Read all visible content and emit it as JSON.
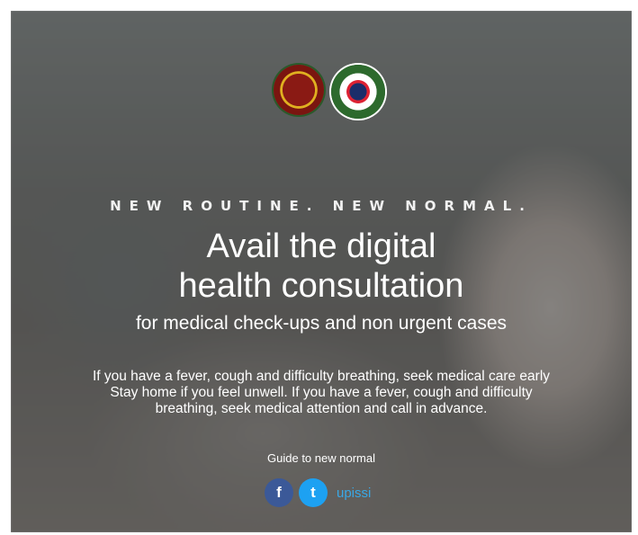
{
  "icons": {
    "logo1": "university-seal-icon",
    "logo2": "institution-seal-icon",
    "facebook": "facebook-icon",
    "twitter": "twitter-icon"
  },
  "colors": {
    "facebook": "#3b5998",
    "twitter": "#1da1f2",
    "handle": "#39a8e6",
    "text": "#ffffff"
  },
  "tagline": "NEW ROUTINE. NEW NORMAL.",
  "headline_line1": "Avail the digital",
  "headline_line2": "health consultation",
  "subhead": "for medical check-ups and non urgent cases",
  "body_line1": "If you have a fever, cough and difficulty breathing, seek medical care early",
  "body_line2": "Stay home if you feel unwell. If you have a fever, cough and difficulty",
  "body_line3": "breathing, seek medical attention and call in advance.",
  "guide": "Guide to new normal",
  "social": {
    "facebook_glyph": "f",
    "twitter_glyph": "t",
    "handle": "upissi"
  }
}
